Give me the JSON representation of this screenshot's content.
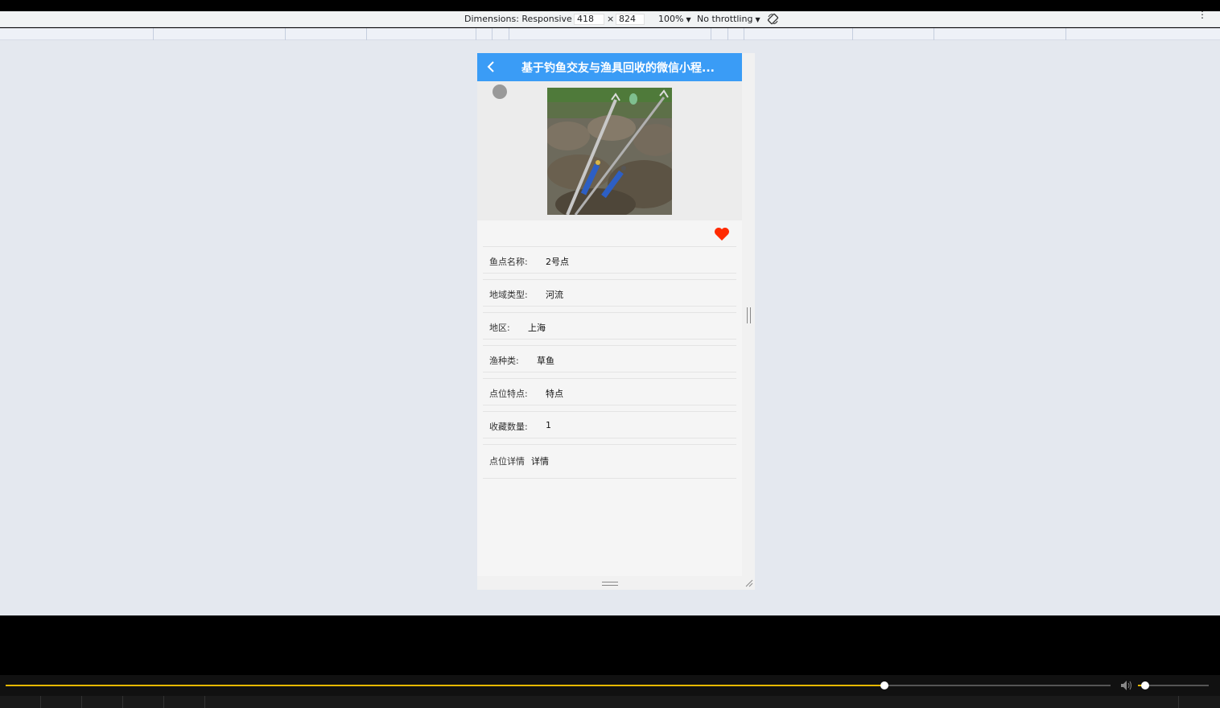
{
  "devtools": {
    "dimensions_label": "Dimensions: Responsive",
    "width": "418",
    "times": "×",
    "height": "824",
    "zoom": "100%",
    "throttling": "No throttling",
    "rotate_icon": "rotate-icon",
    "more_icon": "more-vertical-icon"
  },
  "app": {
    "title": "基于钓鱼交友与渔具回收的微信小程...",
    "back_icon": "chevron-left-icon",
    "favorite_icon": "heart-icon",
    "favorite_color": "#ff2a00",
    "navbar_color": "#3a9cf6",
    "photo_alt": "fishing rod holders on rocks",
    "fields": [
      {
        "label": "鱼点名称:",
        "value": "2号点"
      },
      {
        "label": "地域类型:",
        "value": "河流"
      },
      {
        "label": "地区:",
        "value": "上海"
      },
      {
        "label": "渔种类:",
        "value": "草鱼"
      },
      {
        "label": "点位特点:",
        "value": "特点"
      },
      {
        "label": "收藏数量:",
        "value": "1"
      },
      {
        "label": "点位详情",
        "value": "详情"
      }
    ]
  },
  "player": {
    "progress": 0.795,
    "volume": 0.1,
    "accent_color": "#e6b800",
    "volume_icon": "volume-icon"
  }
}
